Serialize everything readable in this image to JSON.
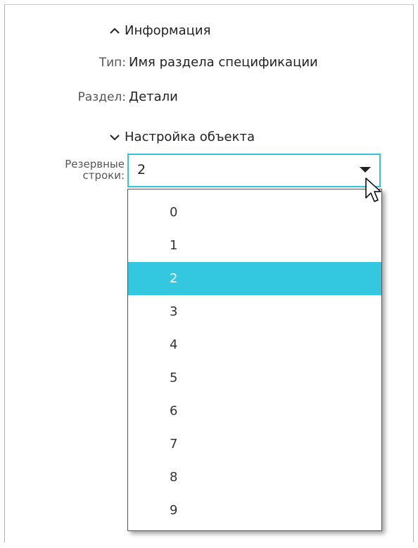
{
  "info_section": {
    "header": "Информация",
    "type_label": "Тип:",
    "type_value": "Имя раздела спецификации",
    "section_label": "Раздел:",
    "section_value": "Детали"
  },
  "settings_section": {
    "header": "Настройка объекта",
    "reserve_label_line1": "Резервные",
    "reserve_label_line2": "строки:",
    "reserve_value": "2"
  },
  "dropdown": {
    "options": [
      "0",
      "1",
      "2",
      "3",
      "4",
      "5",
      "6",
      "7",
      "8",
      "9"
    ],
    "selected": "2"
  },
  "colors": {
    "accent": "#33c8e0"
  },
  "icons": {
    "info_toggle": "chevron-up-icon",
    "settings_toggle": "chevron-down-icon",
    "combo_arrow": "triangle-down-icon",
    "pointer": "mouse-pointer-icon"
  }
}
